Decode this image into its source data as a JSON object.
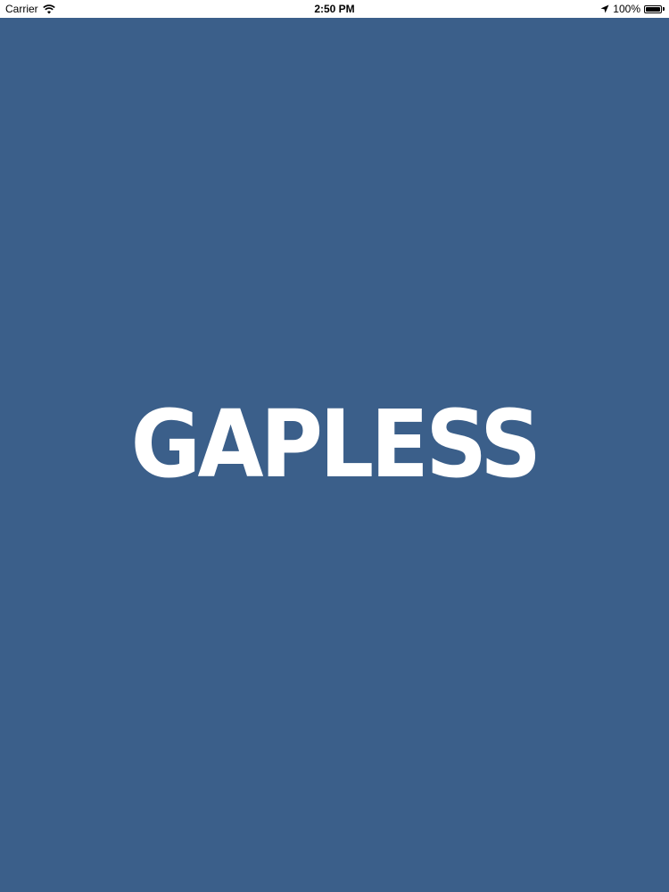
{
  "status_bar": {
    "carrier": "Carrier",
    "time": "2:50 PM",
    "battery_percent": "100%",
    "battery_level": 1.0,
    "icons": [
      "wifi-icon",
      "location-arrow-icon",
      "battery-icon"
    ]
  },
  "splash": {
    "logo_text": "GAPLESS",
    "background_color": "#3b5f8a",
    "logo_color": "#ffffff"
  }
}
